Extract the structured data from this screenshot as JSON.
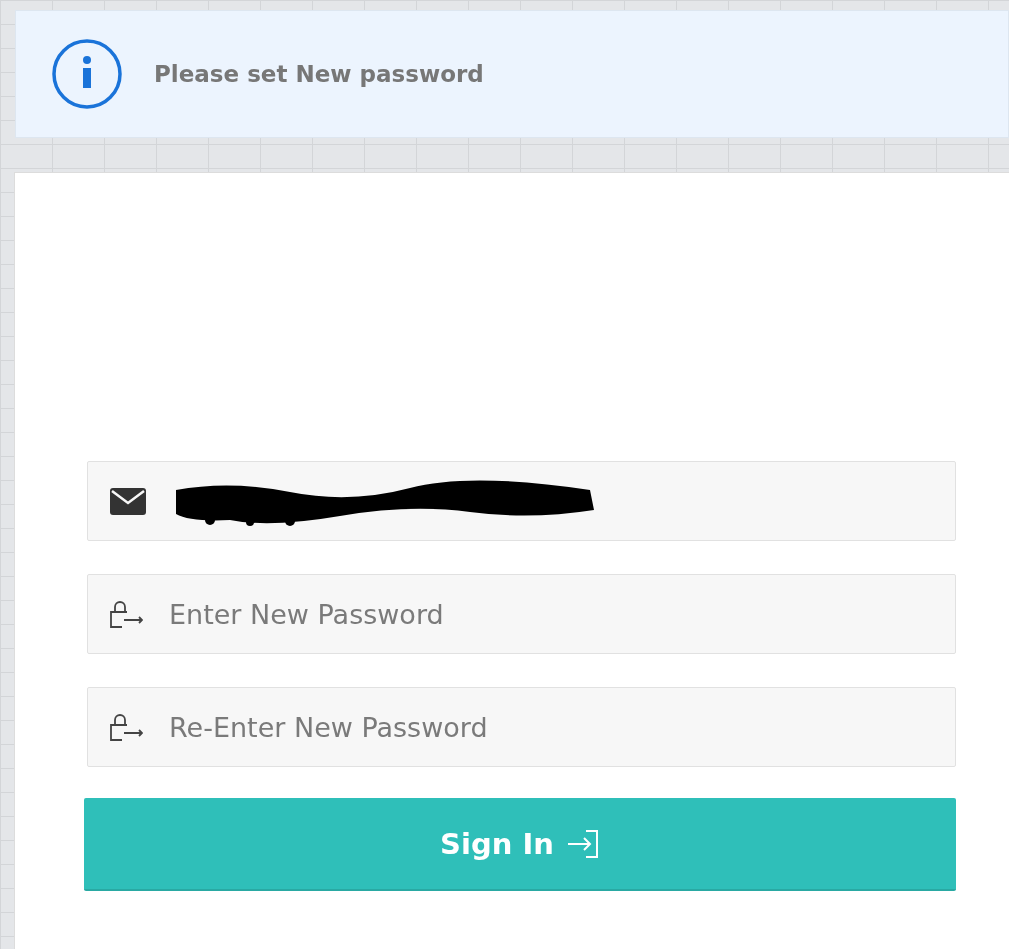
{
  "alert": {
    "kind": "info",
    "message": "Please set New password"
  },
  "fields": [
    {
      "kind": "email",
      "redacted": true
    },
    {
      "kind": "password",
      "placeholder": "Enter New Password"
    },
    {
      "kind": "password",
      "placeholder": "Re-Enter New Password"
    }
  ],
  "submit": {
    "label": "Sign In"
  }
}
